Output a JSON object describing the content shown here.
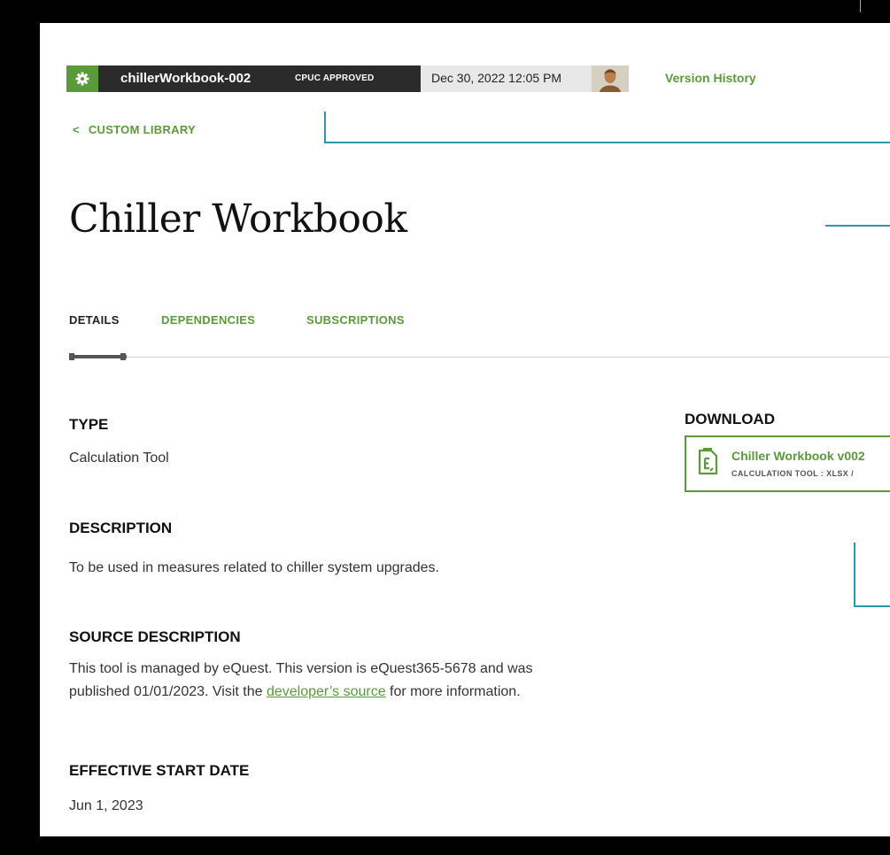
{
  "header": {
    "name": "chillerWorkbook-002",
    "badge": "CPUC APPROVED",
    "date": "Dec 30, 2022 12:05 PM",
    "version_history": "Version History",
    "icons": {
      "settings": "gear-icon",
      "user": "avatar"
    }
  },
  "back_link": {
    "arrow": "<",
    "label": "CUSTOM LIBRARY"
  },
  "page": {
    "title": "Chiller Workbook"
  },
  "tabs": [
    {
      "label": "DETAILS",
      "active": true
    },
    {
      "label": "DEPENDENCIES",
      "active": false
    },
    {
      "label": "SUBSCRIPTIONS",
      "active": false
    }
  ],
  "details": {
    "type": {
      "label": "TYPE",
      "value": "Calculation Tool"
    },
    "description": {
      "label": "DESCRIPTION",
      "value": "To be used in measures related to chiller system upgrades."
    },
    "source": {
      "label": "SOURCE DESCRIPTION",
      "line1": "This tool is managed by eQuest. This version is eQuest365-5678 and was",
      "line2_pre": "published 01/01/2023. Visit the ",
      "link": "developer’s source",
      "line2_post": " for more information."
    },
    "effective_start": {
      "label": "EFFECTIVE START DATE",
      "value": "Jun 1, 2023"
    }
  },
  "download": {
    "label": "DOWNLOAD",
    "file_name": "Chiller Workbook v002",
    "meta": "CALCULATION TOOL : XLSX /",
    "icon": "spreadsheet-file-icon"
  },
  "colors": {
    "accent": "#5b9a3a",
    "header_dark": "#2b2b2b",
    "connector": "#2a9aa8"
  }
}
